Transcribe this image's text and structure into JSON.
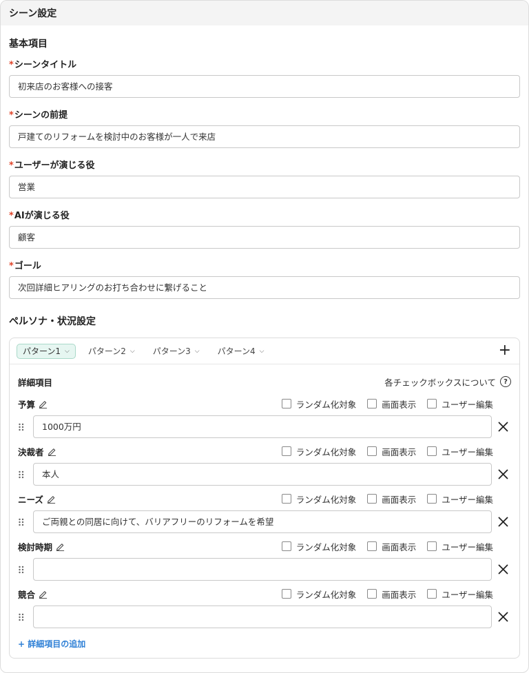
{
  "header": {
    "title": "シーン設定"
  },
  "basic": {
    "title": "基本項目",
    "fields": [
      {
        "required": "*",
        "label": "シーンタイトル",
        "value": "初来店のお客様への接客"
      },
      {
        "required": "*",
        "label": "シーンの前提",
        "value": "戸建てのリフォームを検討中のお客様が一人で来店"
      },
      {
        "required": "*",
        "label": "ユーザーが演じる役",
        "value": "営業"
      },
      {
        "required": "*",
        "label": "AIが演じる役",
        "value": "顧客"
      },
      {
        "required": "*",
        "label": "ゴール",
        "value": "次回詳細ヒアリングのお打ち合わせに繋げること"
      }
    ]
  },
  "persona": {
    "title": "ペルソナ・状況設定",
    "tabs": [
      {
        "label": "パターン1",
        "active": true
      },
      {
        "label": "パターン2",
        "active": false
      },
      {
        "label": "パターン3",
        "active": false
      },
      {
        "label": "パターン4",
        "active": false
      }
    ],
    "add_tab_icon": "plus-icon",
    "detail_title": "詳細項目",
    "help_label": "各チェックボックスについて",
    "check_labels": {
      "random": "ランダム化対象",
      "display": "画面表示",
      "user_edit": "ユーザー編集"
    },
    "items": [
      {
        "name": "予算",
        "value": "1000万円",
        "random": false,
        "display": false,
        "user_edit": false
      },
      {
        "name": "決裁者",
        "value": "本人",
        "random": false,
        "display": false,
        "user_edit": false
      },
      {
        "name": "ニーズ",
        "value": "ご両親との同居に向けて、バリアフリーのリフォームを希望",
        "random": false,
        "display": false,
        "user_edit": false
      },
      {
        "name": "検討時期",
        "value": "",
        "random": false,
        "display": false,
        "user_edit": false
      },
      {
        "name": "競合",
        "value": "",
        "random": false,
        "display": false,
        "user_edit": false
      }
    ],
    "add_item_label": "+ 詳細項目の追加"
  },
  "colors": {
    "required": "#e0452b",
    "active_tab_bg": "#e6f6f1",
    "link": "#2f80d6"
  }
}
